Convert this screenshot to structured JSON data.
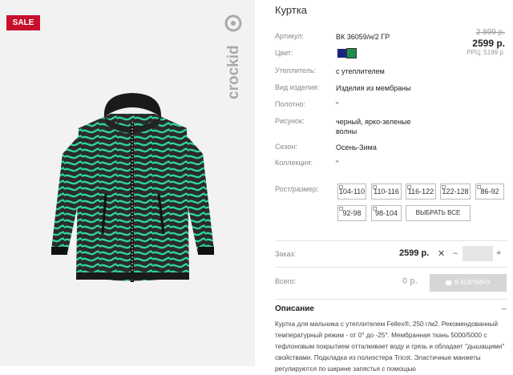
{
  "badge": "SALE",
  "brand_logo": "crockid",
  "product": {
    "title": "Куртка",
    "specs": [
      {
        "label": "Артикул:",
        "value": "ВК 36059/н/2 ГР"
      },
      {
        "label": "Цвет:",
        "value": ""
      },
      {
        "label": "Утеплитель:",
        "value": "с утеплителем"
      },
      {
        "label": "Вид изделия:",
        "value": "Изделия из мембраны"
      },
      {
        "label": "Полотно:",
        "value": "\""
      },
      {
        "label": "Рисунок:",
        "value": "черный, ярко-зеленые волны"
      },
      {
        "label": "Сезон:",
        "value": "Осень-Зима"
      },
      {
        "label": "Коллекция:",
        "value": "\""
      }
    ],
    "colors": [
      "#1a237e",
      "#1e8c4e"
    ],
    "price_old": "2 899 р.",
    "price_new": "2599 р.",
    "rrc": "РРЦ: 5199 р."
  },
  "sizes_label": "Рост/размер:",
  "sizes": [
    "104-110",
    "110-116",
    "116-122",
    "122-128",
    "86-92",
    "92-98",
    "98-104"
  ],
  "select_all": "ВЫБРАТЬ ВСЕ",
  "order": {
    "label": "Заказ:",
    "price": "2599 р.",
    "remove": "✕",
    "minus": "–",
    "plus": "+",
    "qty": ""
  },
  "total": {
    "label": "Всего:",
    "value": "0 р.",
    "cart_button": "В КОРЗИНУ"
  },
  "description": {
    "title": "Описание",
    "text": "Куртка для мальчика с утеплителем Fellex®, 250 г/м2. Рекомендованный температурный режим - от 0° до -25°. Мембранная ткань 5000/5000 с тефлоновым покрытием отталкивает воду и грязь и обладает \"дышащими\" свойствами. Подкладка из полиэстера Tricot. Эластичные манжеты регулируются по ширине запястья с помощью"
  },
  "accent_color": "#c8102e"
}
